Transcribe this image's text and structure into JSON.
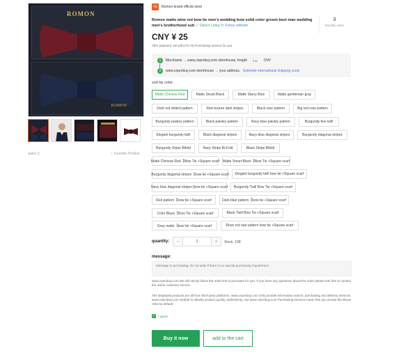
{
  "gallery": {
    "brand": "ROMON",
    "brand_bottom": "ROMON"
  },
  "left_meta": {
    "sales": "Sales 3",
    "favorite": "☆ Favorite Product"
  },
  "store": {
    "logo": "ro",
    "name": "Romon brand official store"
  },
  "product": {
    "title": "Romon matte wine red bow tie men's wedding bow solid color groom best man wedding men's brotherhood suit",
    "link_direct": "Direct Links",
    "link_refresh": "Force refresh",
    "monthly_num": "3",
    "monthly_label": "Monthly sales",
    "price": "CNY ¥ 25",
    "note": "After payment, we will UTC+8) Purchasing service for you."
  },
  "shipping": {
    "step1": "Merchants → www.cnprobuy.com storehouse, freight",
    "step1_tag": "free",
    "step1_cur": "CNY",
    "step2_prefix": "www.cnprobuy.com storehouse → your address,",
    "step2_link": "Estimate international shipping costs"
  },
  "sort_label": "sort by color:",
  "options": [
    "Matte Chinese Red",
    "Matte Smart Black",
    "Matte Starry Blue",
    "Matte gentleman gray",
    "Dark red dotted pattern",
    "Red texture dark stripes",
    "Black rose pattern",
    "Big red rose pattern",
    "Burgundy paisley pattern",
    "Black paisley pattern",
    "Navy blue paisley pattern",
    "Burgundy fine twill",
    "Elegant burgundy twill",
    "Black diagonal stripes",
    "Navy blue diagonal stripes",
    "Burgundy diagonal stripes",
    "Burgundy Stripe Bifold",
    "Navy Stripe Bi-Fold",
    "Black Stripe Bifold",
    "Matte Chinese Red【Bow Tie +Square scarf",
    "Matte Smart Black【Bow Tie +Square scarf",
    "Burgundy diagonal stripes【bow tie +Square scarf",
    "Elegant burgundy twill bow tie +Square scarf",
    "Navy blue diagonal stripes [bow tie +Square scarf",
    "Burgundy Twill Bow Tie +Square scarf",
    "Red pattern【bow tie +Square scarf",
    "Dark blue pattern【bow tie +Square scarf",
    "Color Black【Bow Tie +Square scarf",
    "Black Twill Bow Tie +Square scarf",
    "Gray matte【bow tie +Square scarf",
    "Rose red star pattern bow tie +Square scarf"
  ],
  "quantity": {
    "label": "quantity:",
    "minus": "−",
    "value": "1",
    "plus": "+",
    "stock": "Stock: 198"
  },
  "message": {
    "label": "message:",
    "placeholder": "Message to purchasing, do not write if there is no special purchasing requirement"
  },
  "info1": "www.cnprobuy.com We will strictly follow the order link to purchase for you. If you have any questions about the order please feel free to contact the online customer service.",
  "info2": "The displayed products are all from third-party platforms. www.cnprobuy.com Only provide information search, purchasing and delivery services. www.cnprobuy.com Unable to identify product quality, authenticity, use www.cnprobuy.com Purchasing services mean that you accept the above risks by default.",
  "agree": "I agree",
  "actions": {
    "buy": "Buy it now",
    "cart": "add to the cart"
  },
  "colors": {
    "accent_green": "#25a257",
    "store_orange": "#e8602c"
  }
}
